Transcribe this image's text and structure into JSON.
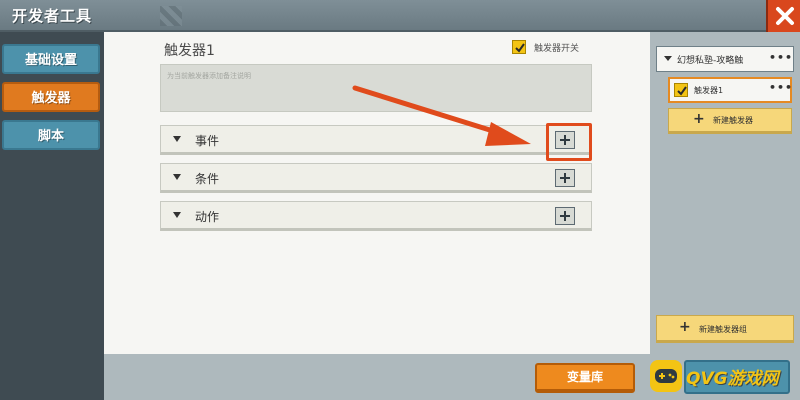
{
  "window": {
    "title": "开发者工具"
  },
  "nav": {
    "items": [
      {
        "label": "基础设置"
      },
      {
        "label": "触发器"
      },
      {
        "label": "脚本"
      }
    ]
  },
  "trigger": {
    "title": "触发器1",
    "switch_label": "触发器开关",
    "description_placeholder": "为当前触发器添加备注说明",
    "sections": [
      {
        "label": "事件"
      },
      {
        "label": "条件"
      },
      {
        "label": "动作"
      }
    ]
  },
  "right_panel": {
    "group_label": "幻想私塾-攻略触",
    "trigger_item": "触发器1",
    "more": "•••",
    "new_trigger": "新建触发器",
    "new_group": "新建触发器组",
    "plus": "+"
  },
  "bottom": {
    "variable_library": "变量库"
  },
  "watermark": {
    "text": "QVG游戏网"
  },
  "colors": {
    "accent_orange": "#e07a1f",
    "nav_blue": "#4d92ab",
    "check_yellow": "#f3c414",
    "highlight_red": "#e04b1c"
  }
}
